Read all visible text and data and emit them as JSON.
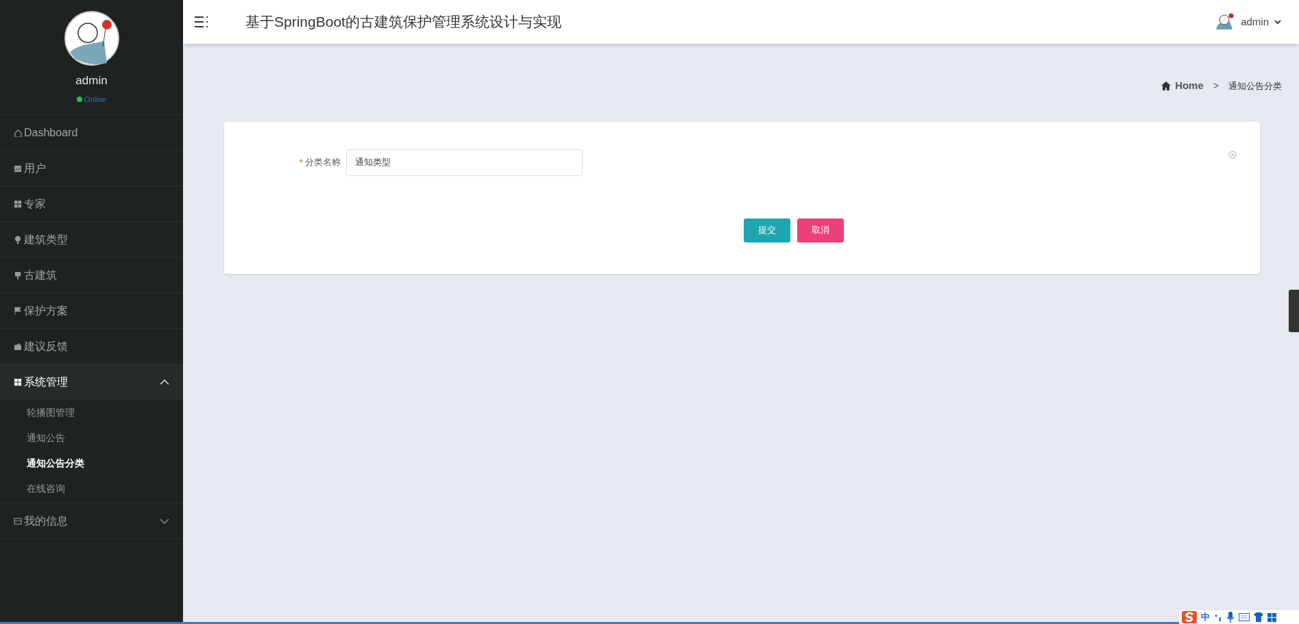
{
  "sidebar": {
    "user": {
      "name": "admin",
      "status": "Online"
    },
    "menu": [
      {
        "label": "Dashboard"
      },
      {
        "label": "用户"
      },
      {
        "label": "专家"
      },
      {
        "label": "建筑类型"
      },
      {
        "label": "古建筑"
      },
      {
        "label": "保护方案"
      },
      {
        "label": "建议反馈"
      },
      {
        "label": "系统管理",
        "expanded": true,
        "children": [
          {
            "label": "轮播图管理",
            "selected": false
          },
          {
            "label": "通知公告",
            "selected": false
          },
          {
            "label": "通知公告分类",
            "selected": true
          },
          {
            "label": "在线咨询",
            "selected": false
          }
        ]
      },
      {
        "label": "我的信息",
        "expanded": false
      }
    ]
  },
  "header": {
    "title": "基于SpringBoot的古建筑保护管理系统设计与实现",
    "user": "admin"
  },
  "breadcrumb": {
    "home": "Home",
    "separator": ">",
    "current": "通知公告分类"
  },
  "form": {
    "fields": [
      {
        "label": "分类名称",
        "required_mark": "*",
        "value": "通知类型"
      }
    ],
    "buttons": [
      {
        "label": "提交",
        "kind": "primary"
      },
      {
        "label": "取消",
        "kind": "danger"
      }
    ]
  },
  "ime": {
    "mode": "中"
  }
}
